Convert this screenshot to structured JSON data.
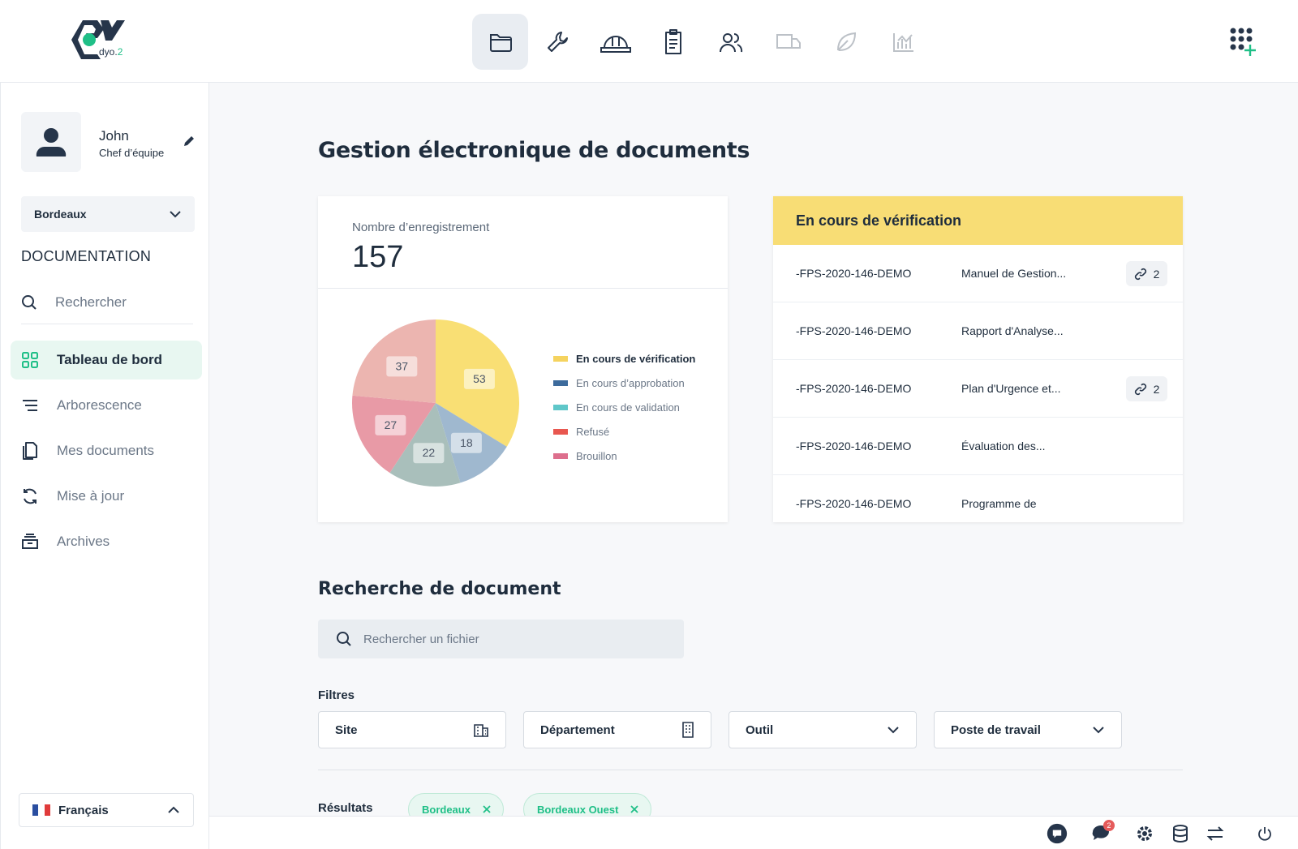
{
  "app": {
    "logo_text": "dyo.",
    "logo_version": "2"
  },
  "topnav": {
    "tabs": [
      {
        "icon": "folder-icon",
        "active": true,
        "disabled": false
      },
      {
        "icon": "wrench-icon",
        "active": false,
        "disabled": false
      },
      {
        "icon": "hard-hat-icon",
        "active": false,
        "disabled": false
      },
      {
        "icon": "clipboard-icon",
        "active": false,
        "disabled": false
      },
      {
        "icon": "users-icon",
        "active": false,
        "disabled": false
      },
      {
        "icon": "truck-icon",
        "active": false,
        "disabled": true
      },
      {
        "icon": "leaf-icon",
        "active": false,
        "disabled": true
      },
      {
        "icon": "bar-chart-icon",
        "active": false,
        "disabled": true
      }
    ],
    "apps_icon": "apps-grid-plus-icon"
  },
  "sidebar": {
    "user": {
      "name": "John",
      "role": "Chef d’équipe"
    },
    "site_select": "Bordeaux",
    "section_heading": "DOCUMENTATION",
    "search_placeholder": "Rechercher",
    "items": [
      {
        "label": "Tableau de bord",
        "icon": "dashboard-icon",
        "active": true
      },
      {
        "label": "Arborescence",
        "icon": "tree-icon",
        "active": false
      },
      {
        "label": "Mes documents",
        "icon": "documents-icon",
        "active": false
      },
      {
        "label": "Mise à jour",
        "icon": "refresh-icon",
        "active": false
      },
      {
        "label": "Archives",
        "icon": "archive-icon",
        "active": false
      }
    ],
    "language": "Français"
  },
  "main": {
    "title": "Gestion électronique de documents",
    "stats": {
      "label": "Nombre d’enregistrement",
      "value": "157"
    },
    "verification": {
      "title": "En cours de vérification",
      "rows": [
        {
          "ref": "-FPS-2020-146-DEMO",
          "doc": "Manuel de Gestion...",
          "links": "2"
        },
        {
          "ref": "-FPS-2020-146-DEMO",
          "doc": "Rapport d'Analyse...",
          "links": null
        },
        {
          "ref": "-FPS-2020-146-DEMO",
          "doc": "Plan d'Urgence et...",
          "links": "2"
        },
        {
          "ref": "-FPS-2020-146-DEMO",
          "doc": "Évaluation des...",
          "links": null
        },
        {
          "ref": "-FPS-2020-146-DEMO",
          "doc": "Programme de",
          "links": null
        }
      ]
    },
    "search_section": {
      "title": "Recherche de document",
      "placeholder": "Rechercher un fichier",
      "filters_label": "Filtres",
      "filters": [
        {
          "label": "Site",
          "icon": "building-icon"
        },
        {
          "label": "Département",
          "icon": "building-tall-icon"
        },
        {
          "label": "Outil",
          "icon": "chevron-down-icon"
        },
        {
          "label": "Poste de travail",
          "icon": "chevron-down-icon"
        }
      ],
      "results_label": "Résultats",
      "chips": [
        "Bordeaux",
        "Bordeaux Ouest"
      ]
    }
  },
  "bottombar": {
    "icons": [
      "chat-icon",
      "notifications-icon",
      "settings-icon",
      "database-icon",
      "swap-icon",
      "power-icon"
    ],
    "notification_count": "2"
  },
  "colors": {
    "accent": "#1fbf87",
    "verif_header": "#f8dd75",
    "dark": "#1f2d3d"
  },
  "chart_data": {
    "type": "pie",
    "title": "",
    "total": 157,
    "series": [
      {
        "name": "En cours de vérification",
        "value": 53,
        "color": "#f9df74"
      },
      {
        "name": "En cours d'approbation",
        "value": 18,
        "color": "#9fb8cf"
      },
      {
        "name": "En cours de validation",
        "value": 22,
        "color": "#a9bfbb"
      },
      {
        "name": "Refusé",
        "value": 27,
        "color": "#e89aa6"
      },
      {
        "name": "Brouillon",
        "value": 37,
        "color": "#ecb5b0"
      }
    ],
    "legend": [
      {
        "name": "En cours de vérification",
        "color": "#f5d35f"
      },
      {
        "name": "En cours d’approbation",
        "color": "#3d6b9c"
      },
      {
        "name": "En cours de validation",
        "color": "#5fc7c9"
      },
      {
        "name": "Refusé",
        "color": "#e8574f"
      },
      {
        "name": "Brouillon",
        "color": "#dd6f8d"
      }
    ],
    "legend_position": "right"
  }
}
